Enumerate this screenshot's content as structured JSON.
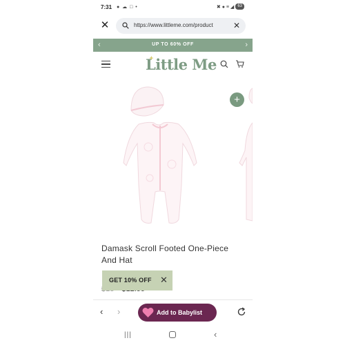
{
  "status_bar": {
    "time": "7:31",
    "left_icons": "● ☁ □ •",
    "right_icons": "✖ ● ≡ ◢",
    "battery": "63"
  },
  "url_bar": {
    "url": "https://www.littleme.com/product"
  },
  "promo": {
    "text": "UP TO 60% OFF"
  },
  "header": {
    "logo": "Little Me"
  },
  "product": {
    "title_line1": "Damask Scroll Footed One-Piece",
    "title_line2": "And Hat",
    "price_old": "$18",
    "price_new": "$12.99"
  },
  "discount_popup": {
    "label": "GET 10% OFF"
  },
  "toolbar": {
    "babylist_label": "Add to Babylist"
  },
  "colors": {
    "promo_bg": "#86a48c",
    "brand_green": "#7e9c84",
    "babylist_purple": "#6b2751",
    "discount_bg": "#c6d2b4"
  }
}
